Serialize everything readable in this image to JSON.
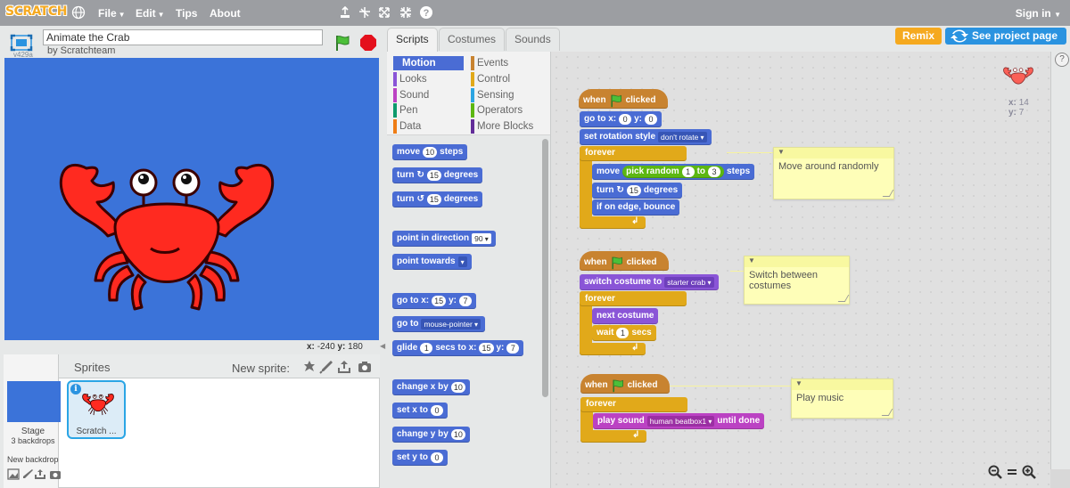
{
  "topbar": {
    "logo": "SCRATCH",
    "menu": [
      "File",
      "Edit",
      "Tips",
      "About"
    ],
    "tools": [
      "duplicate-icon",
      "cut-icon",
      "grow-icon",
      "shrink-icon",
      "help-icon"
    ],
    "signin": "Sign in"
  },
  "project": {
    "title": "Animate the Crab",
    "byline": "by Scratchteam",
    "version": "v429a"
  },
  "stage": {
    "background_color": "#3b73d9",
    "mouse_x_label": "x:",
    "mouse_x": "-240",
    "mouse_y_label": "y:",
    "mouse_y": "180"
  },
  "sprites_pane": {
    "title": "Sprites",
    "new_sprite_label": "New sprite:",
    "stage_label": "Stage",
    "stage_sub": "3 backdrops",
    "new_backdrop_label": "New backdrop",
    "sprite_name": "Scratch ..."
  },
  "tabs": [
    "Scripts",
    "Costumes",
    "Sounds"
  ],
  "buttons": {
    "remix": "Remix",
    "see_project_page": "See project page"
  },
  "categories": [
    {
      "label": "Motion",
      "color": "#4a6cd4"
    },
    {
      "label": "Looks",
      "color": "#8a55d7"
    },
    {
      "label": "Sound",
      "color": "#bb42c3"
    },
    {
      "label": "Pen",
      "color": "#0e9a6c"
    },
    {
      "label": "Data",
      "color": "#ee7d16"
    },
    {
      "label": "Events",
      "color": "#c88330"
    },
    {
      "label": "Control",
      "color": "#e1a91a"
    },
    {
      "label": "Sensing",
      "color": "#2ca5e2"
    },
    {
      "label": "Operators",
      "color": "#5cb712"
    },
    {
      "label": "More Blocks",
      "color": "#632d99"
    }
  ],
  "palette": {
    "move": {
      "pre": "move",
      "val": "10",
      "post": "steps"
    },
    "turn_cw": {
      "pre": "turn",
      "val": "15",
      "post": "degrees"
    },
    "turn_ccw": {
      "pre": "turn",
      "val": "15",
      "post": "degrees"
    },
    "point_dir": {
      "pre": "point in direction",
      "val": "90"
    },
    "point_towards": {
      "pre": "point towards",
      "val": ""
    },
    "go_to_xy": {
      "pre": "go to x:",
      "x": "15",
      "ylabel": "y:",
      "y": "7"
    },
    "go_to": {
      "pre": "go to",
      "val": "mouse-pointer"
    },
    "glide": {
      "pre": "glide",
      "secs": "1",
      "mid": "secs to x:",
      "x": "15",
      "ylabel": "y:",
      "y": "7"
    },
    "change_x": {
      "pre": "change x by",
      "val": "10"
    },
    "set_x": {
      "pre": "set x to",
      "val": "0"
    },
    "change_y": {
      "pre": "change y by",
      "val": "10"
    },
    "set_y": {
      "pre": "set y to",
      "val": "0"
    }
  },
  "scripts": {
    "s1": {
      "hat_pre": "when",
      "hat_post": "clicked",
      "goto_pre": "go to x:",
      "goto_x": "0",
      "goto_ylabel": "y:",
      "goto_y": "0",
      "rot_pre": "set rotation style",
      "rot_val": "don't rotate",
      "forever": "forever",
      "move_pre": "move",
      "pick_pre": "pick random",
      "pick_a": "1",
      "pick_mid": "to",
      "pick_b": "3",
      "move_post": "steps",
      "turn_pre": "turn",
      "turn_val": "15",
      "turn_post": "degrees",
      "bounce": "if on edge, bounce",
      "comment": "Move around randomly"
    },
    "s2": {
      "hat_pre": "when",
      "hat_post": "clicked",
      "switch_pre": "switch costume to",
      "switch_val": "starter crab",
      "forever": "forever",
      "next": "next costume",
      "wait_pre": "wait",
      "wait_val": "1",
      "wait_post": "secs",
      "comment": "Switch between costumes"
    },
    "s3": {
      "hat_pre": "when",
      "hat_post": "clicked",
      "forever": "forever",
      "play_pre": "play sound",
      "play_val": "human beatbox1",
      "play_post": "until done",
      "comment": "Play music"
    }
  },
  "sprite_info": {
    "x_label": "x:",
    "x": "14",
    "y_label": "y:",
    "y": "7"
  },
  "help": "?",
  "colors": {
    "accent": "#2a93e0",
    "remix": "#f5a91f",
    "topbar": "#9c9ea2"
  }
}
